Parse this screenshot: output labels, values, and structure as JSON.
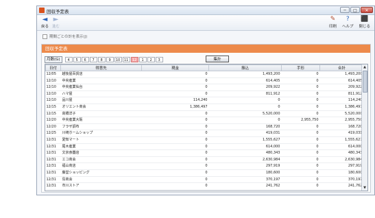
{
  "window": {
    "title": "回収予定表",
    "min": "─",
    "max": "□",
    "close": "✕"
  },
  "toolbar": {
    "back_label": "戻る",
    "forward_label": "進む",
    "print_label": "印刷",
    "help_label": "ヘルプ",
    "close_label": "閉じる",
    "back_icon": "◄",
    "forward_icon": "►",
    "print_icon": "✎",
    "help_icon": "?",
    "close_icon": "⬛"
  },
  "options": {
    "show_blank_label": "期間ごとの計を表示(J)"
  },
  "panel": {
    "title": "回収予定表"
  },
  "months": {
    "label": "月数(G)",
    "buttons": [
      "4",
      "5",
      "6",
      "7",
      "8",
      "9",
      "10",
      "11",
      "12",
      "1",
      "2",
      "3"
    ],
    "active": "12"
  },
  "sum_button": "集計",
  "table": {
    "headers": [
      "日付",
      "得意先",
      "現金",
      "振込",
      "手形",
      "合計"
    ],
    "rows": [
      [
        "12/05",
        "越後屋百貨店",
        "0",
        "1,493,200",
        "0",
        "1,493,200"
      ],
      [
        "12/10",
        "中央産業",
        "0",
        "614,405",
        "0",
        "614,405"
      ],
      [
        "12/10",
        "中央産業仙台",
        "0",
        "209,922",
        "0",
        "209,922"
      ],
      [
        "12/10",
        "ハマ屋",
        "0",
        "811,912",
        "0",
        "811,912"
      ],
      [
        "12/10",
        "品川屋",
        "114,240",
        "0",
        "0",
        "114,240"
      ],
      [
        "12/15",
        "オリエント商会",
        "1,386,497",
        "0",
        "0",
        "1,386,497"
      ],
      [
        "12/15",
        "高橋洋子",
        "0",
        "5,520,000",
        "0",
        "5,520,000"
      ],
      [
        "12/20",
        "中央産業大阪",
        "0",
        "0",
        "2,955,750",
        "2,955,750"
      ],
      [
        "12/20",
        "フラザ調布",
        "0",
        "168,720",
        "0",
        "168,720"
      ],
      [
        "12/25",
        "川崎ホームショップ",
        "0",
        "419,031",
        "0",
        "419,031"
      ],
      [
        "12/31",
        "愛知マート",
        "0",
        "1,555,627",
        "0",
        "1,555,627"
      ],
      [
        "12/31",
        "尾木産業",
        "0",
        "614,000",
        "0",
        "614,000"
      ],
      [
        "12/31",
        "文京食器店",
        "0",
        "480,343",
        "0",
        "480,343"
      ],
      [
        "12/31",
        "エコ商会",
        "0",
        "2,630,984",
        "0",
        "2,630,984"
      ],
      [
        "12/31",
        "福山商店",
        "0",
        "297,919",
        "0",
        "297,919"
      ],
      [
        "12/31",
        "藤堂ショッピング",
        "0",
        "180,600",
        "0",
        "180,600"
      ],
      [
        "12/31",
        "島商会",
        "0",
        "370,197",
        "0",
        "370,197"
      ],
      [
        "12/31",
        "市川ストア",
        "0",
        "241,762",
        "0",
        "241,762"
      ]
    ]
  }
}
